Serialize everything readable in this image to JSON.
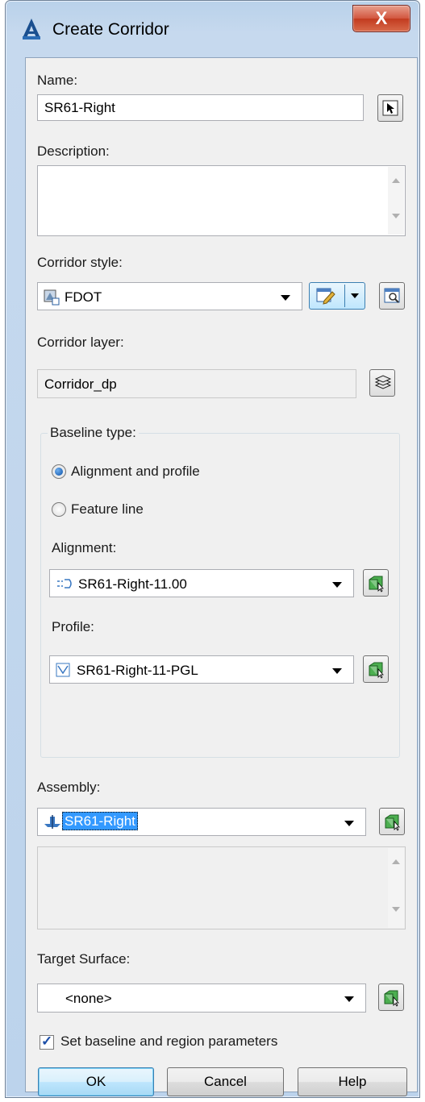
{
  "window": {
    "title": "Create Corridor",
    "close_glyph": "X"
  },
  "name": {
    "label": "Name:",
    "value": "SR61-Right"
  },
  "description": {
    "label": "Description:",
    "value": ""
  },
  "corridor_style": {
    "label": "Corridor style:",
    "value": "FDOT"
  },
  "corridor_layer": {
    "label": "Corridor layer:",
    "value": "Corridor_dp"
  },
  "baseline": {
    "title": "Baseline type:",
    "options": [
      {
        "label": "Alignment and profile",
        "selected": true
      },
      {
        "label": "Feature line",
        "selected": false
      }
    ],
    "alignment": {
      "label": "Alignment:",
      "value": "SR61-Right-11.00"
    },
    "profile": {
      "label": "Profile:",
      "value": "SR61-Right-11-PGL"
    }
  },
  "assembly": {
    "label": "Assembly:",
    "value": "SR61-Right"
  },
  "target_surface": {
    "label": "Target Surface:",
    "value": "<none>"
  },
  "set_params": {
    "label": "Set baseline and region parameters",
    "checked": true
  },
  "buttons": {
    "ok": "OK",
    "cancel": "Cancel",
    "help": "Help"
  },
  "colors": {
    "accent": "#3399ff",
    "title_bg": "#b9d1ea",
    "close_red": "#c23b1f",
    "dialog_bg": "#f0f0f0"
  },
  "icons": [
    "autocad-app-icon",
    "close-icon",
    "pick-from-drawing-icon",
    "scroll-up-icon",
    "scroll-down-icon",
    "corridor-style-icon",
    "edit-style-icon",
    "preview-style-icon",
    "layer-icon",
    "alignment-icon",
    "profile-icon",
    "assembly-icon",
    "select-object-icon",
    "checkmark-icon"
  ]
}
